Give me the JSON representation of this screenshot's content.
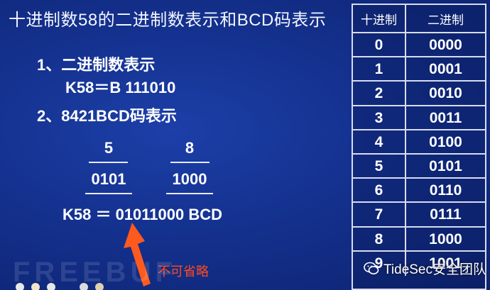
{
  "slide": {
    "title": "十进制数58的二进制数表示和BCD码表示",
    "step1_label": "1、二进制数表示",
    "step1_value": "K58＝B 111010",
    "step2_label": "2、8421BCD码表示",
    "digit_a": "5",
    "digit_b": "8",
    "bcd_a": "0101",
    "bcd_b": "1000",
    "result": "K58 ＝ 01011000 BCD",
    "omit_note": "不可省略"
  },
  "table": {
    "headers": [
      "十进制",
      "二进制"
    ],
    "rows": [
      [
        "0",
        "0000"
      ],
      [
        "1",
        "0001"
      ],
      [
        "2",
        "0010"
      ],
      [
        "3",
        "0011"
      ],
      [
        "4",
        "0100"
      ],
      [
        "5",
        "0101"
      ],
      [
        "6",
        "0110"
      ],
      [
        "7",
        "0111"
      ],
      [
        "8",
        "1000"
      ],
      [
        "9",
        "1001"
      ]
    ]
  },
  "watermark": "FREEBUF",
  "brand": "TideSec安全团队",
  "colors": {
    "background": "#14318e",
    "arrow": "#ff5a1e",
    "note": "#ff4a22"
  }
}
